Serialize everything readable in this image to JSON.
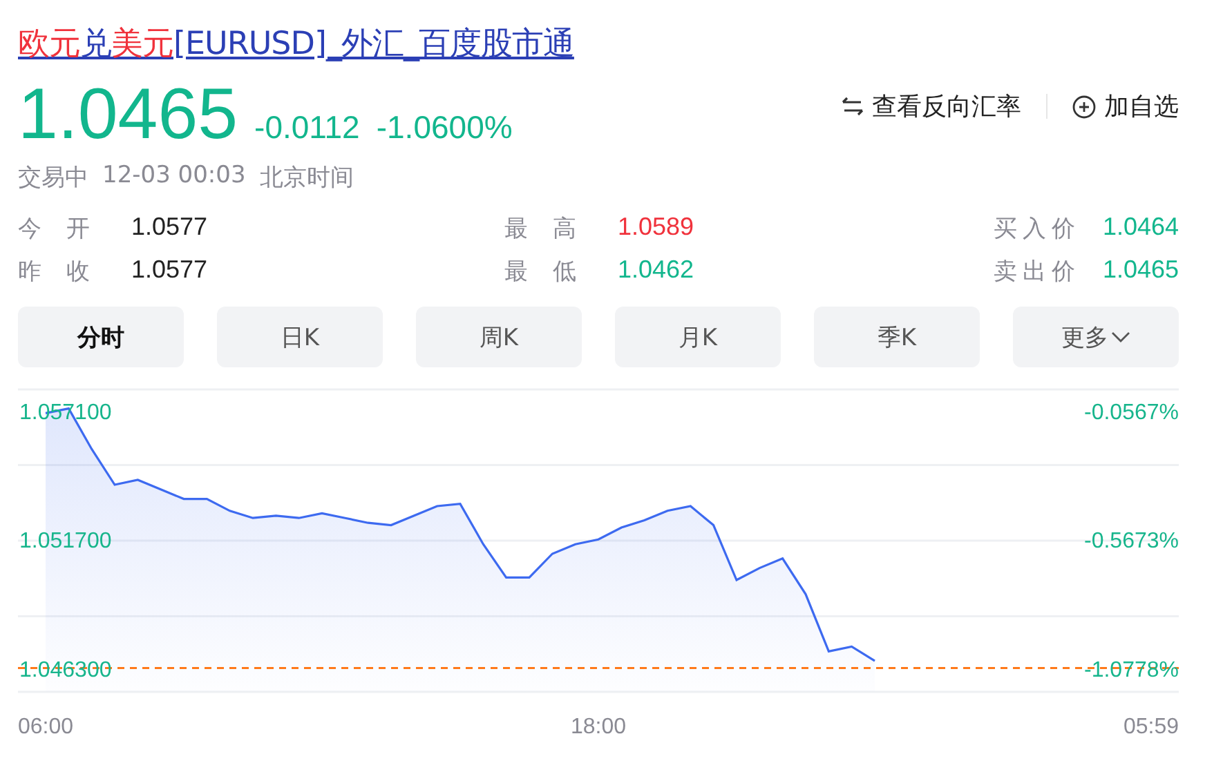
{
  "title": {
    "parts": [
      {
        "text": "欧元",
        "highlight": true
      },
      {
        "text": "兑",
        "highlight": false
      },
      {
        "text": "美元",
        "highlight": true
      },
      {
        "text": "[EURUSD]_外汇_百度股市通",
        "highlight": false
      }
    ]
  },
  "quote": {
    "price": "1.0465",
    "change": "-0.0112",
    "change_percent": "-1.0600%",
    "color": "#12b68d",
    "status": "交易中",
    "time": "12-03 00:03",
    "timezone": "北京时间"
  },
  "actions": [
    {
      "kind": "swap",
      "label": "查看反向汇率"
    },
    {
      "kind": "add",
      "label": "加自选"
    }
  ],
  "stats": [
    {
      "label": "今开",
      "value": "1.0577",
      "color": "#222222"
    },
    {
      "label": "最高",
      "value": "1.0589",
      "color": "#f0323c"
    },
    {
      "label": "买入价",
      "value": "1.0464",
      "color": "#12b68d"
    },
    {
      "label": "昨收",
      "value": "1.0577",
      "color": "#222222"
    },
    {
      "label": "最低",
      "value": "1.0462",
      "color": "#12b68d"
    },
    {
      "label": "卖出价",
      "value": "1.0465",
      "color": "#12b68d"
    }
  ],
  "tabs": [
    {
      "label": "分时",
      "selected": true,
      "dropdown": false
    },
    {
      "label": "日K",
      "selected": false,
      "dropdown": false
    },
    {
      "label": "周K",
      "selected": false,
      "dropdown": false
    },
    {
      "label": "月K",
      "selected": false,
      "dropdown": false
    },
    {
      "label": "季K",
      "selected": false,
      "dropdown": false
    },
    {
      "label": "更多",
      "selected": false,
      "dropdown": true
    }
  ],
  "chart": {
    "percent_labels": [
      "-0.0567%",
      "-0.5673%",
      "-1.0778%"
    ],
    "chart_data": {
      "type": "area",
      "ylim": [
        1.0453,
        1.058
      ],
      "categories": [
        "06:00",
        null,
        null,
        null,
        null,
        null,
        null,
        null,
        null,
        null,
        null,
        null,
        null,
        null,
        null,
        null,
        null,
        null,
        null,
        null,
        null,
        null,
        null,
        null,
        "18:00",
        null,
        null,
        null,
        null,
        null,
        null,
        null,
        null,
        null,
        null,
        null,
        null,
        null,
        null,
        null,
        null,
        null,
        null,
        null,
        null,
        null,
        null,
        null,
        "05:59"
      ],
      "yticks": [
        {
          "value": 1.0571,
          "label": "1.057100"
        },
        {
          "value": 1.0517,
          "label": "1.051700"
        }
      ],
      "series": [
        {
          "color": "#3d6af0",
          "values": [
            1.057,
            1.0572,
            1.0555,
            1.054,
            1.0542,
            1.0538,
            1.0534,
            1.0534,
            1.0529,
            1.0526,
            1.0527,
            1.0526,
            1.0528,
            1.0526,
            1.0524,
            1.0523,
            1.0527,
            1.0531,
            1.0532,
            1.0515,
            1.0501,
            1.0501,
            1.0511,
            1.0515,
            1.0517,
            1.0522,
            1.0525,
            1.0529,
            1.0531,
            1.0523,
            1.05,
            1.0505,
            1.0509,
            1.0494,
            1.047,
            1.0472,
            1.0466,
            null,
            null,
            null,
            null,
            null,
            null,
            null,
            null,
            null,
            null,
            null,
            null
          ]
        }
      ],
      "ref_lines": [
        {
          "axis": "y",
          "value": 1.0463,
          "label": "1.046300",
          "color": "#ff7a1a"
        }
      ]
    }
  }
}
